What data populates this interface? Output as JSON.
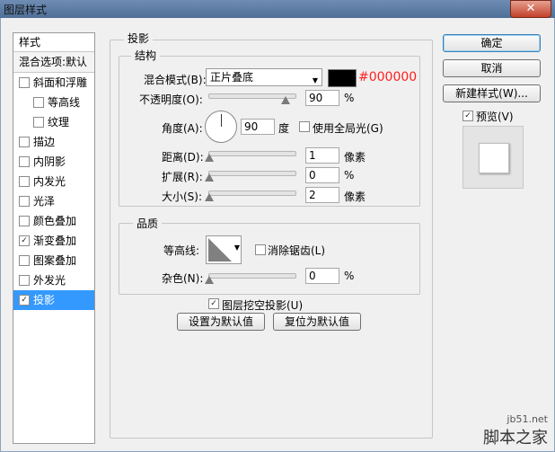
{
  "window": {
    "title": "图层样式",
    "close_symbol": "✕"
  },
  "styles_list": {
    "header": "样式",
    "blend_options": "混合选项:默认",
    "items": [
      {
        "label": "斜面和浮雕",
        "checked": false
      },
      {
        "label": "等高线",
        "checked": false,
        "indent": true
      },
      {
        "label": "纹理",
        "checked": false,
        "indent": true
      },
      {
        "label": "描边",
        "checked": false
      },
      {
        "label": "内阴影",
        "checked": false
      },
      {
        "label": "内发光",
        "checked": false
      },
      {
        "label": "光泽",
        "checked": false
      },
      {
        "label": "颜色叠加",
        "checked": false
      },
      {
        "label": "渐变叠加",
        "checked": true
      },
      {
        "label": "图案叠加",
        "checked": false
      },
      {
        "label": "外发光",
        "checked": false
      },
      {
        "label": "投影",
        "checked": true,
        "active": true
      }
    ]
  },
  "drop_shadow": {
    "section_title": "投影",
    "structure": {
      "title": "结构",
      "blend_mode_label": "混合模式(B):",
      "blend_mode_value": "正片叠底",
      "color_hex": "#000000",
      "opacity_label": "不透明度(O):",
      "opacity_value": "90",
      "opacity_unit": "%",
      "angle_label": "角度(A):",
      "angle_value": "90",
      "angle_unit": "度",
      "global_light_label": "使用全局光(G)",
      "distance_label": "距离(D):",
      "distance_value": "1",
      "distance_unit": "像素",
      "spread_label": "扩展(R):",
      "spread_value": "0",
      "spread_unit": "%",
      "size_label": "大小(S):",
      "size_value": "2",
      "size_unit": "像素"
    },
    "quality": {
      "title": "品质",
      "contour_label": "等高线:",
      "anti_alias_label": "消除锯齿(L)",
      "noise_label": "杂色(N):",
      "noise_value": "0",
      "noise_unit": "%"
    },
    "knockout_label": "图层挖空投影(U)",
    "make_default": "设置为默认值",
    "reset_default": "复位为默认值"
  },
  "buttons": {
    "ok": "确定",
    "cancel": "取消",
    "new_style": "新建样式(W)...",
    "preview": "预览(V)",
    "check_mark": "✓",
    "arrow": "▼"
  },
  "watermark": {
    "site": "jb51.net",
    "name": "脚本之家"
  }
}
